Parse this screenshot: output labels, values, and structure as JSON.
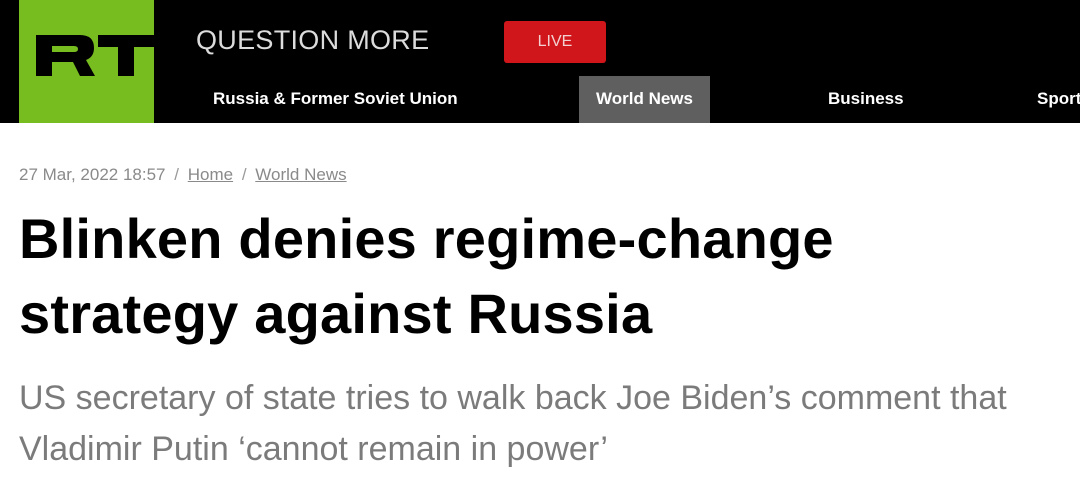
{
  "header": {
    "logo_text": "RT",
    "tagline": "QUESTION MORE",
    "live_label": "LIVE",
    "colors": {
      "logo_bg": "#77bd1f",
      "live_bg": "#d0161b",
      "header_bg": "#000000",
      "active_nav_bg": "#5f5f5f"
    }
  },
  "nav": {
    "items": [
      {
        "label": "Russia & Former Soviet Union",
        "active": false
      },
      {
        "label": "World News",
        "active": true
      },
      {
        "label": "Business",
        "active": false
      },
      {
        "label": "Sport",
        "active": false
      }
    ]
  },
  "article": {
    "date": "27 Mar, 2022 18:57",
    "breadcrumb": [
      {
        "label": "Home"
      },
      {
        "label": "World News"
      }
    ],
    "headline_line1": "Blinken denies regime-change",
    "headline_line2": "strategy against Russia",
    "subheadline_line1": "US secretary of state tries to walk back Joe Biden’s comment that",
    "subheadline_line2": "Vladimir Putin ‘cannot remain in power’"
  }
}
